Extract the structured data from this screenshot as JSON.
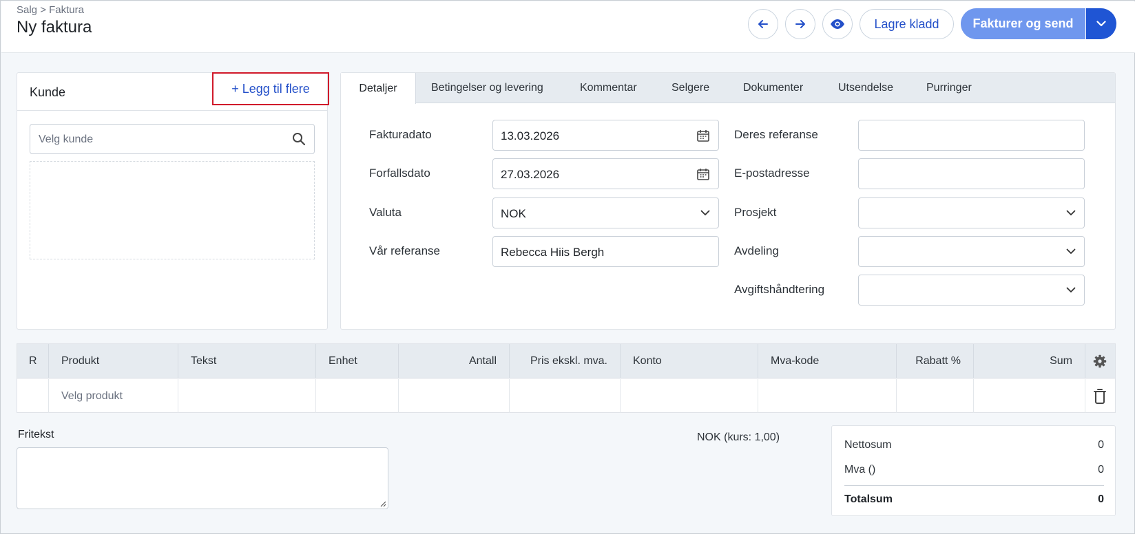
{
  "header": {
    "breadcrumb": "Salg > Faktura",
    "title": "Ny faktura",
    "save_draft_label": "Lagre kladd",
    "invoice_send_label": "Fakturer og send"
  },
  "customer": {
    "title": "Kunde",
    "add_more_label": "+ Legg til flere",
    "search_placeholder": "Velg kunde"
  },
  "tabs": [
    "Detaljer",
    "Betingelser og levering",
    "Kommentar",
    "Selgere",
    "Dokumenter",
    "Utsendelse",
    "Purringer"
  ],
  "details": {
    "left": [
      {
        "label": "Fakturadato",
        "value": "13.03.2026",
        "icon": "calendar-icon"
      },
      {
        "label": "Forfallsdato",
        "value": "27.03.2026",
        "icon": "calendar-icon"
      },
      {
        "label": "Valuta",
        "value": "NOK",
        "icon": "chevron-down-icon"
      },
      {
        "label": "Vår referanse",
        "value": "Rebecca Hiis Bergh"
      }
    ],
    "right": [
      {
        "label": "Deres referanse",
        "value": ""
      },
      {
        "label": "E-postadresse",
        "value": ""
      },
      {
        "label": "Prosjekt",
        "value": "",
        "icon": "chevron-down-icon"
      },
      {
        "label": "Avdeling",
        "value": "",
        "icon": "chevron-down-icon"
      },
      {
        "label": "Avgiftshåndtering",
        "value": "",
        "icon": "chevron-down-icon"
      }
    ]
  },
  "table": {
    "columns": [
      "R",
      "Produkt",
      "Tekst",
      "Enhet",
      "Antall",
      "Pris ekskl. mva.",
      "Konto",
      "Mva-kode",
      "Rabatt %",
      "Sum"
    ],
    "row": {
      "product_placeholder": "Velg produkt"
    }
  },
  "fritekst": {
    "label": "Fritekst",
    "value": ""
  },
  "currency_info": "NOK (kurs: 1,00)",
  "totals": {
    "net_label": "Nettosum",
    "net_value": "0",
    "vat_label": "Mva ()",
    "vat_value": "0",
    "total_label": "Totalsum",
    "total_value": "0"
  },
  "colors": {
    "accent": "#2450c9",
    "primary_button": "#6f97ee",
    "primary_dropdown": "#1f55d4",
    "highlight_border": "#d0192a"
  }
}
